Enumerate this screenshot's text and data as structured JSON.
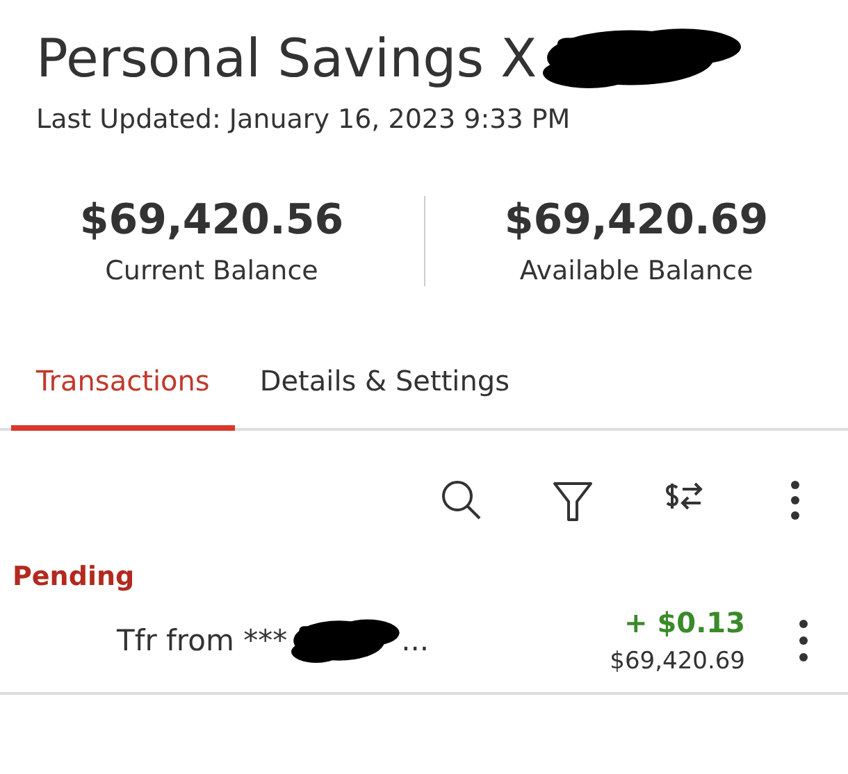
{
  "account": {
    "title": "Personal Savings X",
    "updated": "Last Updated: January 16, 2023 9:33 PM"
  },
  "balances": [
    {
      "amount": "$69,420.56",
      "label": "Current Balance"
    },
    {
      "amount": "$69,420.69",
      "label": "Available Balance"
    }
  ],
  "tabs": [
    {
      "label": "Transactions",
      "selected": true
    },
    {
      "label": "Details & Settings",
      "selected": false
    }
  ],
  "toolbar": [
    {
      "kind": "search"
    },
    {
      "kind": "filter"
    },
    {
      "kind": "exchange"
    },
    {
      "kind": "more"
    }
  ],
  "sections": [
    {
      "heading": "Pending",
      "transactions": [
        {
          "description": "Tfr from ***",
          "ellipsis": "...",
          "amount": "+ $0.13",
          "balance": "$69,420.69"
        }
      ]
    }
  ]
}
